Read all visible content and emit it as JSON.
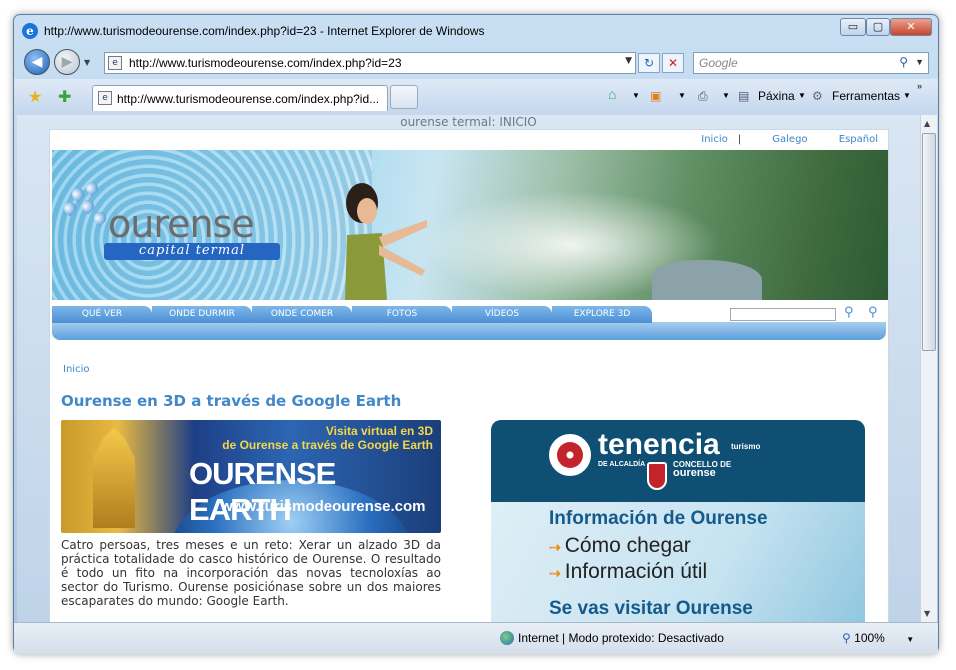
{
  "window": {
    "title": "http://www.turismodeourense.com/index.php?id=23 - Internet Explorer de Windows",
    "minimize": "▭",
    "maximize": "▢",
    "close": "✕"
  },
  "address_bar": {
    "url": "http://www.turismodeourense.com/index.php?id=23",
    "search_placeholder": "Google"
  },
  "tab": {
    "label": "http://www.turismodeourense.com/index.php?id..."
  },
  "command_bar": {
    "page_label": "Páxina",
    "tools_label": "Ferramentas"
  },
  "status_bar": {
    "zone": "Internet | Modo protexido: Desactivado",
    "zoom": "100%"
  },
  "page": {
    "doc_title": "ourense termal: INICIO",
    "lang_links": [
      "Inicio",
      "Galego",
      "Español"
    ],
    "logo_name": "ourense",
    "logo_tagline": "capital termal",
    "nav": [
      "QUÉ VER",
      "ONDE DURMIR",
      "ONDE COMER",
      "FOTOS",
      "VÍDEOS",
      "EXPLORE 3D"
    ],
    "breadcrumb": "Inicio",
    "heading": "Ourense en 3D a través de Google Earth",
    "earth_banner": {
      "line1": "Visita virtual en 3D",
      "line2": "de Ourense a través de Google Earth",
      "title": "OURENSE EARTH",
      "url": "www.turismodeourense.com"
    },
    "article": "Catro persoas, tres meses e un reto: Xerar un alzado 3D da práctica totalidade do casco histórico de Ourense. O resultado é todo un fito na incorporación das novas tecnoloxías ao sector do Turismo. Ourense posiciónase sobre un dos maiores escaparates do mundo: Google Earth.",
    "tenencia": {
      "title": "tenencia",
      "sub1": "DE ALCALDÍA",
      "sub2a": "CONCELLO DE",
      "sub2b": "ourense",
      "tag": "turismo",
      "info_heading": "Información de Ourense",
      "link1": "Cómo chegar",
      "link2": "Información útil",
      "visit_heading": "Se vas visitar Ourense"
    }
  }
}
